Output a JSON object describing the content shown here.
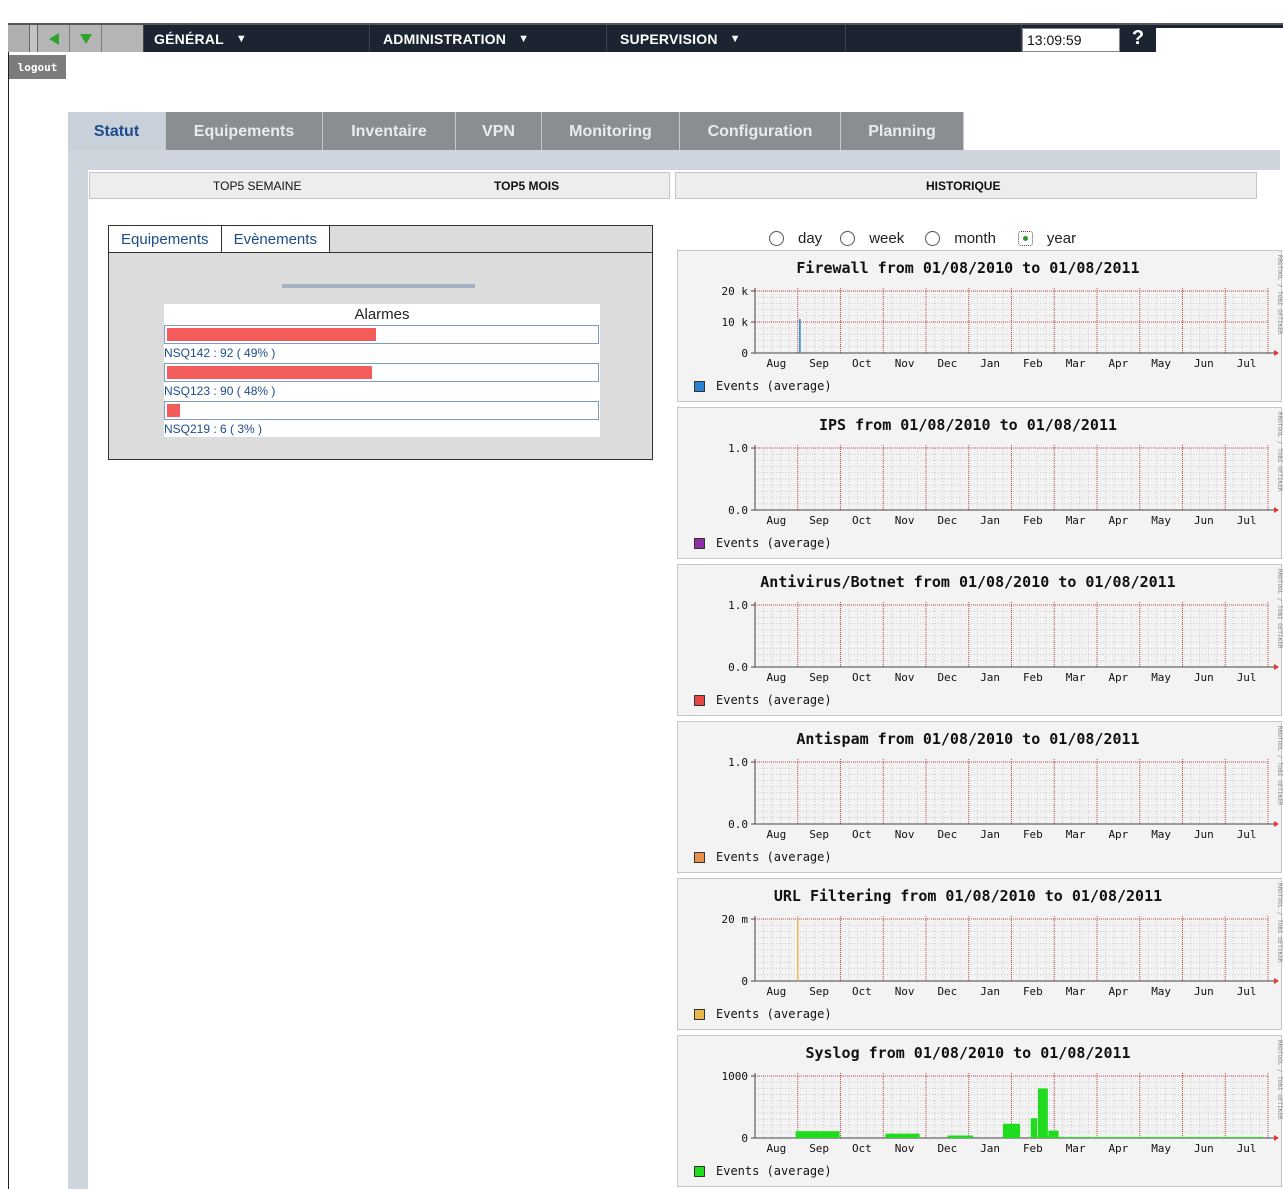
{
  "topbar": {
    "menus": [
      {
        "label": "GÉNÉRAL",
        "arrow": "▼"
      },
      {
        "label": "ADMINISTRATION",
        "arrow": "▼"
      },
      {
        "label": "SUPERVISION",
        "arrow": "▼"
      }
    ],
    "clock": "13:09:59",
    "help": "?"
  },
  "logout": "logout",
  "tabs": [
    "Statut",
    "Equipements",
    "Inventaire",
    "VPN",
    "Monitoring",
    "Configuration",
    "Planning"
  ],
  "active_tab": "Statut",
  "sections": {
    "top5_semaine": "TOP5 SEMAINE",
    "top5_mois": "TOP5 MOIS",
    "historique": "HISTORIQUE"
  },
  "widget": {
    "tabs": [
      "Equipements",
      "Evènements"
    ],
    "title": "Alarmes",
    "bars": [
      {
        "label": "NSQ142 : 92 ( 49% )",
        "value": 92,
        "percent": 49
      },
      {
        "label": "NSQ123 : 90 ( 48% )",
        "value": 90,
        "percent": 48
      },
      {
        "label": "NSQ219 : 6 ( 3% )",
        "value": 6,
        "percent": 3
      }
    ]
  },
  "radios": [
    {
      "label": "day",
      "selected": false
    },
    {
      "label": "week",
      "selected": false
    },
    {
      "label": "month",
      "selected": false
    },
    {
      "label": "year",
      "selected": true
    }
  ],
  "months": [
    "Aug",
    "Sep",
    "Oct",
    "Nov",
    "Dec",
    "Jan",
    "Feb",
    "Mar",
    "Apr",
    "May",
    "Jun",
    "Jul"
  ],
  "side_text": "RRDTOOL / TOBI OETIKER",
  "graphs": [
    {
      "title": "Firewall from 01/08/2010 to 01/08/2011",
      "legend": "Events (average)",
      "color": "#2d7fd1",
      "yticks": [
        "20 k",
        "10 k",
        "0"
      ],
      "chart_data": {
        "type": "area",
        "x": [
          "Aug",
          "Sep",
          "Oct",
          "Nov",
          "Dec",
          "Jan",
          "Feb",
          "Mar",
          "Apr",
          "May",
          "Jun",
          "Jul"
        ],
        "ylim": [
          0,
          20000
        ],
        "spike_at_month": 1.05,
        "spike_value": 11000
      }
    },
    {
      "title": "IPS from 01/08/2010 to 01/08/2011",
      "legend": "Events (average)",
      "color": "#8e2fa8",
      "yticks": [
        "1.0",
        "0.0"
      ],
      "chart_data": {
        "type": "area",
        "ylim": [
          0,
          1
        ],
        "values": []
      }
    },
    {
      "title": "Antivirus/Botnet from 01/08/2010 to 01/08/2011",
      "legend": "Events (average)",
      "color": "#e84646",
      "yticks": [
        "1.0",
        "0.0"
      ],
      "chart_data": {
        "type": "area",
        "ylim": [
          0,
          1
        ],
        "values": []
      }
    },
    {
      "title": "Antispam from 01/08/2010 to 01/08/2011",
      "legend": "Events (average)",
      "color": "#e8914a",
      "yticks": [
        "1.0",
        "0.0"
      ],
      "chart_data": {
        "type": "area",
        "ylim": [
          0,
          1
        ],
        "values": []
      }
    },
    {
      "title": "URL Filtering from 01/08/2010 to 01/08/2011",
      "legend": "Events (average)",
      "color": "#e8b84a",
      "yticks": [
        "20 m",
        "0"
      ],
      "chart_data": {
        "type": "area",
        "ylim": [
          0,
          0.03
        ],
        "spike_at_month": 1.0,
        "spike_value": 0.03
      }
    },
    {
      "title": "Syslog from 01/08/2010 to 01/08/2011",
      "legend": "Events (average)",
      "color": "#1fdc1f",
      "yticks": [
        "1000",
        "0"
      ],
      "chart_data": {
        "type": "area",
        "ylim": [
          0,
          1000
        ],
        "segments": [
          {
            "from": 0.95,
            "to": 1.98,
            "value": 110
          },
          {
            "from": 3.05,
            "to": 3.85,
            "value": 70
          },
          {
            "from": 4.5,
            "to": 5.1,
            "value": 40
          },
          {
            "from": 5.8,
            "to": 6.2,
            "value": 230
          },
          {
            "from": 6.45,
            "to": 6.6,
            "value": 320
          },
          {
            "from": 6.62,
            "to": 6.85,
            "value": 800
          },
          {
            "from": 6.86,
            "to": 7.1,
            "value": 120
          },
          {
            "from": 7.1,
            "to": 11.9,
            "value": 15
          }
        ]
      }
    }
  ]
}
